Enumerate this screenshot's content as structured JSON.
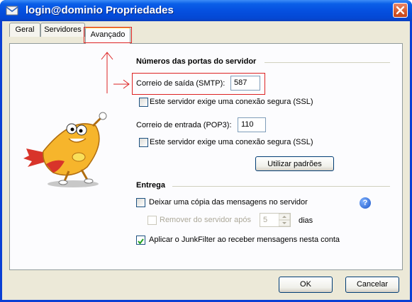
{
  "window": {
    "title": "login@dominio Propriedades"
  },
  "tabs": [
    {
      "label": "Geral",
      "active": false
    },
    {
      "label": "Servidores",
      "active": false
    },
    {
      "label": "Avançado",
      "active": true
    }
  ],
  "ports": {
    "title": "Números das portas do servidor",
    "smtp_label": "Correio de saída (SMTP):",
    "smtp_value": "587",
    "smtp_ssl_label": "Este servidor exige uma conexão segura (SSL)",
    "smtp_ssl_checked": false,
    "pop3_label": "Correio de entrada (POP3):",
    "pop3_value": "110",
    "pop3_ssl_label": "Este servidor exige uma conexão segura (SSL)",
    "pop3_ssl_checked": false,
    "defaults_button": "Utilizar padrões"
  },
  "delivery": {
    "title": "Entrega",
    "keep_copy_label": "Deixar uma cópia das mensagens no servidor",
    "keep_copy_checked": false,
    "remove_label": "Remover do servidor após",
    "remove_days_value": "5",
    "days_label": "dias",
    "junk_label": "Aplicar o JunkFilter ao receber mensagens nesta conta",
    "junk_checked": true
  },
  "footer": {
    "ok": "OK",
    "cancel": "Cancelar"
  },
  "colors": {
    "titlebar": "#0550e0",
    "annotation": "#dd2222",
    "dialog": "#ece9d8"
  }
}
